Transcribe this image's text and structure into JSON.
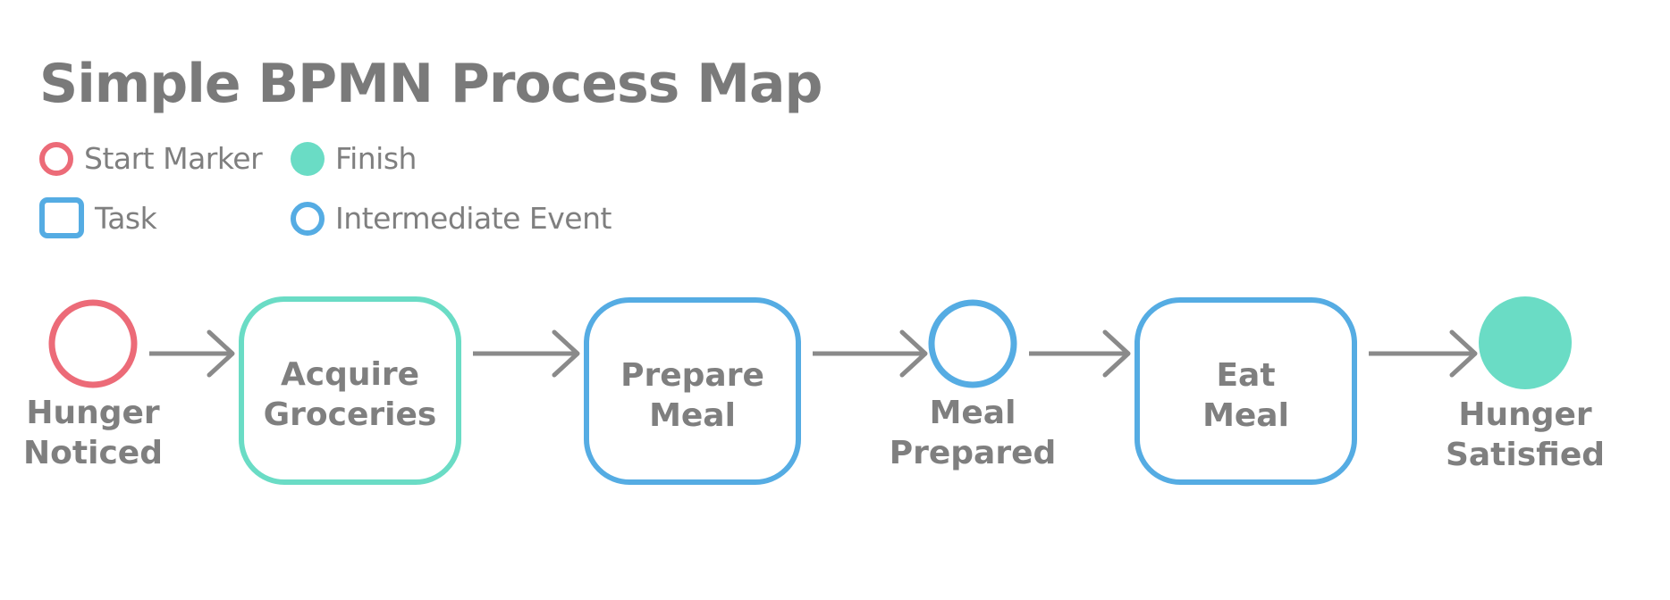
{
  "title": "Simple BPMN Process Map",
  "colors": {
    "start": "#EC6B78",
    "finish": "#6ADCC5",
    "task_blue": "#55ACE3",
    "task_teal": "#6ADCC5",
    "intermediate": "#55ACE3",
    "arrow": "#8a8a8a",
    "text": "#7f7f7f"
  },
  "legend": [
    {
      "label": "Start Marker",
      "shape": "circle-outline",
      "color": "#EC6B78"
    },
    {
      "label": "Finish",
      "shape": "circle-filled",
      "color": "#6ADCC5"
    },
    {
      "label": "Task",
      "shape": "rounded-square-outline",
      "color": "#55ACE3"
    },
    {
      "label": "Intermediate Event",
      "shape": "circle-outline",
      "color": "#55ACE3"
    }
  ],
  "nodes": [
    {
      "id": "start",
      "type": "start-event",
      "label_lines": [
        "Hunger",
        "Noticed"
      ],
      "color": "#EC6B78"
    },
    {
      "id": "acquire",
      "type": "task",
      "label_lines": [
        "Acquire",
        "Groceries"
      ],
      "color": "#6ADCC5"
    },
    {
      "id": "prepare",
      "type": "task",
      "label_lines": [
        "Prepare",
        "Meal"
      ],
      "color": "#55ACE3"
    },
    {
      "id": "prepared",
      "type": "intermediate-event",
      "label_lines": [
        "Meal",
        "Prepared"
      ],
      "color": "#55ACE3"
    },
    {
      "id": "eat",
      "type": "task",
      "label_lines": [
        "Eat",
        "Meal"
      ],
      "color": "#55ACE3"
    },
    {
      "id": "finish",
      "type": "end-event",
      "label_lines": [
        "Hunger",
        "Satisfied"
      ],
      "color": "#6ADCC5"
    }
  ],
  "edges": [
    {
      "from": "start",
      "to": "acquire"
    },
    {
      "from": "acquire",
      "to": "prepare"
    },
    {
      "from": "prepare",
      "to": "prepared"
    },
    {
      "from": "prepared",
      "to": "eat"
    },
    {
      "from": "eat",
      "to": "finish"
    }
  ]
}
